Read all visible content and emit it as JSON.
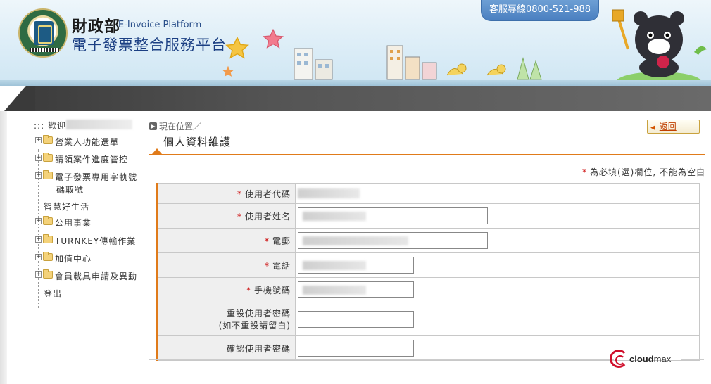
{
  "header": {
    "ministry": "財政部",
    "platform_en": "E-Invoice Platform",
    "platform_zh": "電子發票整合服務平台",
    "hotline": "客服專線0800-521-988"
  },
  "sidebar": {
    "welcome": "::: 歡迎",
    "items": [
      {
        "label": "營業人功能選單"
      },
      {
        "label": "請領案件進度管控"
      },
      {
        "label": "電子發票專用字軌號"
      },
      {
        "label": "碼取號"
      },
      {
        "label": "智慧好生活"
      },
      {
        "label": "公用事業"
      },
      {
        "label": "TURNKEY傳輸作業"
      },
      {
        "label": "加值中心"
      },
      {
        "label": "會員載具申請及異動"
      },
      {
        "label": "登出"
      }
    ]
  },
  "main": {
    "breadcrumb": "現在位置／",
    "back_label": "返回",
    "page_title": "個人資料維護",
    "required_note": "為必填(選)欄位, 不能為空白",
    "fields": [
      {
        "label": "使用者代碼",
        "required": "*"
      },
      {
        "label": "使用者姓名",
        "required": "*"
      },
      {
        "label": "電郵",
        "required": "*"
      },
      {
        "label": "電話",
        "required": "*"
      },
      {
        "label": "手機號碼",
        "required": "*"
      },
      {
        "label": "重設使用者密碼",
        "label2": "(如不重設請留白)",
        "required": ""
      },
      {
        "label": "確認使用者密碼",
        "required": ""
      }
    ]
  },
  "footer": {
    "brand_bold": "cloud",
    "brand_light": "max"
  },
  "colors": {
    "accent": "#e07b1a",
    "required": "#cc0000",
    "hotline_bg": "#4a7fc0",
    "dark_bar": "#3a3a3a"
  }
}
